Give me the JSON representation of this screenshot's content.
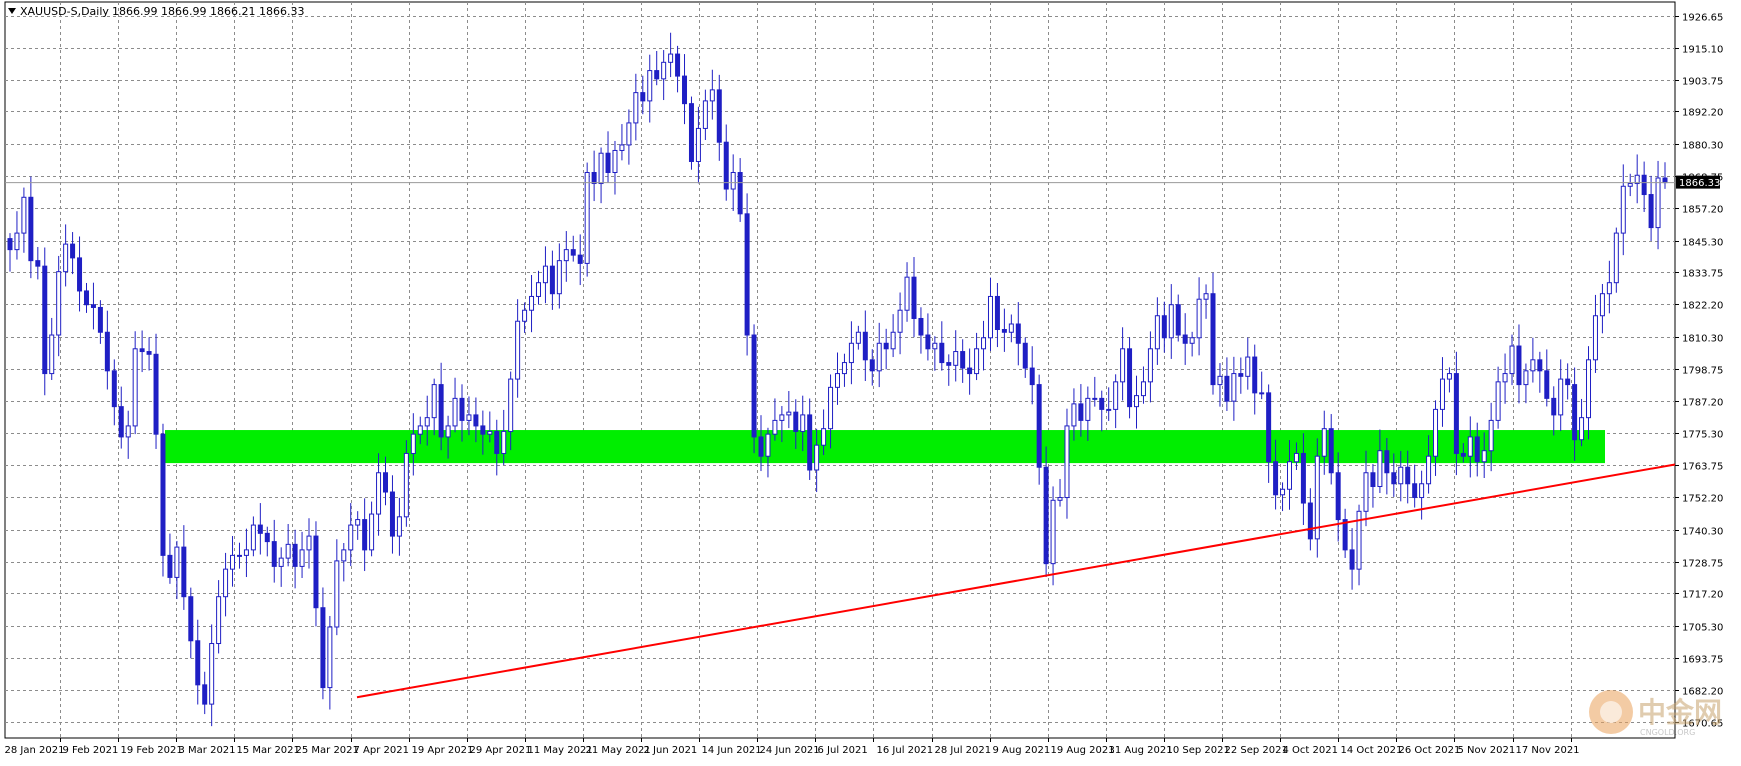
{
  "header": {
    "symbol": "XAUUSD-S,Daily",
    "ohlc": "1866.99 1866.99 1866.21 1866.33"
  },
  "watermark": {
    "brand": "中金网",
    "sub": "CNGOLD.ORG"
  },
  "colors": {
    "candle": "#1f1fc4",
    "grid": "#8c8c8c",
    "zone": "#00ee00",
    "trendline": "#ff0000",
    "price_label_bg": "#000000",
    "price_label_text": "#ffffff",
    "background": "#ffffff"
  },
  "chart_data": {
    "type": "candlestick",
    "symbol": "XAUUSD-S",
    "timeframe": "Daily",
    "ylim": [
      1664.7,
      1931.9
    ],
    "grid": true,
    "current_price": 1866.33,
    "y_ticks": [
      "1926.65",
      "1915.10",
      "1903.75",
      "1892.20",
      "1880.30",
      "1868.75",
      "1857.20",
      "1845.30",
      "1833.75",
      "1822.20",
      "1810.30",
      "1798.75",
      "1787.20",
      "1775.30",
      "1763.75",
      "1752.20",
      "1740.30",
      "1728.75",
      "1717.20",
      "1705.30",
      "1693.75",
      "1682.20",
      "1670.65"
    ],
    "x_ticks": [
      "28 Jan 2021",
      "9 Feb 2021",
      "19 Feb 2021",
      "3 Mar 2021",
      "15 Mar 2021",
      "25 Mar 2021",
      "7 Apr 2021",
      "19 Apr 2021",
      "29 Apr 2021",
      "11 May 2021",
      "21 May 2021",
      "2 Jun 2021",
      "14 Jun 2021",
      "24 Jun 2021",
      "6 Jul 2021",
      "16 Jul 2021",
      "28 Jul 2021",
      "9 Aug 2021",
      "19 Aug 2021",
      "31 Aug 2021",
      "10 Sep 2021",
      "22 Sep 2021",
      "4 Oct 2021",
      "14 Oct 2021",
      "26 Oct 2021",
      "5 Nov 2021",
      "17 Nov 2021"
    ],
    "closes": [
      1842,
      1848,
      1861,
      1838,
      1836,
      1797,
      1811,
      1834,
      1844,
      1839,
      1827,
      1822,
      1821,
      1812,
      1798,
      1785,
      1774,
      1778,
      1806,
      1805,
      1804,
      1775,
      1731,
      1723,
      1734,
      1716,
      1700,
      1684,
      1677,
      1699,
      1716,
      1726,
      1731,
      1731,
      1733,
      1742,
      1739,
      1736,
      1727,
      1730,
      1735,
      1727,
      1733,
      1738,
      1712,
      1683,
      1705,
      1729,
      1733,
      1742,
      1744,
      1733,
      1746,
      1761,
      1754,
      1738,
      1745,
      1768,
      1775,
      1778,
      1781,
      1793,
      1774,
      1778,
      1788,
      1780,
      1782,
      1778,
      1775,
      1776,
      1768,
      1776,
      1795,
      1816,
      1820,
      1825,
      1830,
      1836,
      1826,
      1838,
      1842,
      1840,
      1837,
      1870,
      1866,
      1877,
      1870,
      1878,
      1880,
      1888,
      1899,
      1896,
      1907,
      1904,
      1910,
      1913,
      1905,
      1895,
      1874,
      1886,
      1896,
      1900,
      1881,
      1864,
      1870,
      1855,
      1811,
      1774,
      1767,
      1775,
      1780,
      1782,
      1783,
      1776,
      1782,
      1762,
      1771,
      1777,
      1792,
      1797,
      1801,
      1808,
      1812,
      1802,
      1798,
      1808,
      1806,
      1812,
      1820,
      1832,
      1817,
      1811,
      1806,
      1808,
      1801,
      1800,
      1805,
      1799,
      1797,
      1806,
      1810,
      1825,
      1813,
      1812,
      1815,
      1808,
      1799,
      1793,
      1763,
      1728,
      1751,
      1752,
      1778,
      1786,
      1780,
      1788,
      1788,
      1784,
      1784,
      1794,
      1806,
      1785,
      1789,
      1794,
      1806,
      1818,
      1810,
      1822,
      1811,
      1808,
      1810,
      1824,
      1826,
      1793,
      1796,
      1787,
      1797,
      1796,
      1803,
      1790,
      1790,
      1765,
      1753,
      1755,
      1765,
      1768,
      1750,
      1737,
      1767,
      1777,
      1761,
      1744,
      1733,
      1726,
      1747,
      1761,
      1756,
      1769,
      1761,
      1757,
      1763,
      1757,
      1752,
      1757,
      1767,
      1784,
      1795,
      1797,
      1768,
      1767,
      1774,
      1765,
      1769,
      1780,
      1794,
      1797,
      1807,
      1793,
      1798,
      1802,
      1798,
      1788,
      1782,
      1795,
      1793,
      1773,
      1781,
      1802,
      1818,
      1826,
      1830,
      1848,
      1865,
      1866,
      1869,
      1862,
      1850,
      1868,
      1866.33
    ]
  }
}
